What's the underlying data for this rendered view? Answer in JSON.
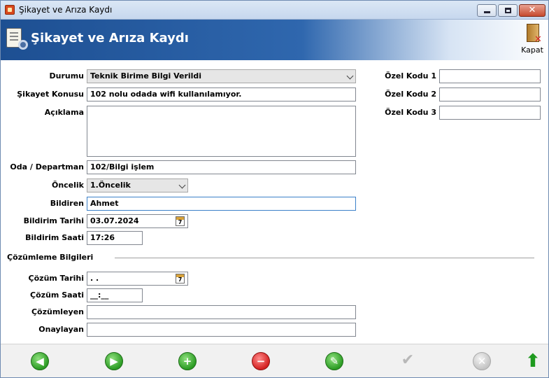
{
  "window": {
    "title": "Şikayet ve Arıza Kaydı",
    "close_glyph": "✕"
  },
  "header": {
    "title": "Şikayet ve Arıza Kaydı",
    "close_label": "Kapat"
  },
  "form": {
    "status": {
      "label": "Durumu",
      "value": "Teknik Birime Bilgi Verildi"
    },
    "subject": {
      "label": "Şikayet Konusu",
      "value": "102 nolu odada wifi kullanılamıyor."
    },
    "description": {
      "label": "Açıklama",
      "value": ""
    },
    "room": {
      "label": "Oda / Departman",
      "value": "102/Bilgi işlem"
    },
    "priority": {
      "label": "Öncelik",
      "value": "1.Öncelik"
    },
    "reporter": {
      "label": "Bildiren",
      "value": "Ahmet"
    },
    "report_date": {
      "label": "Bildirim Tarihi",
      "value": "03.07.2024"
    },
    "report_time": {
      "label": "Bildirim Saati",
      "value": "17:26"
    },
    "custom_code_1": {
      "label": "Özel Kodu 1",
      "value": ""
    },
    "custom_code_2": {
      "label": "Özel Kodu 2",
      "value": ""
    },
    "custom_code_3": {
      "label": "Özel Kodu 3",
      "value": ""
    }
  },
  "resolution": {
    "section_title": "Çözümleme Bilgileri",
    "date": {
      "label": "Çözüm Tarihi",
      "value": " . ."
    },
    "time": {
      "label": "Çözüm Saati",
      "value": "__:__"
    },
    "resolver": {
      "label": "Çözümleyen",
      "value": ""
    },
    "approver": {
      "label": "Onaylayan",
      "value": ""
    }
  },
  "calendar_day": "7",
  "toolbar": {
    "prev_glyph": "◀",
    "next_glyph": "▶",
    "add_glyph": "+",
    "delete_glyph": "−",
    "edit_glyph": "✎",
    "save_glyph": "✔",
    "cancel_glyph": "✕",
    "up_glyph": "⬆"
  },
  "colors": {
    "header_blue": "#1d4f92",
    "nav_green": "#2c9c24",
    "delete_red": "#d42020"
  }
}
